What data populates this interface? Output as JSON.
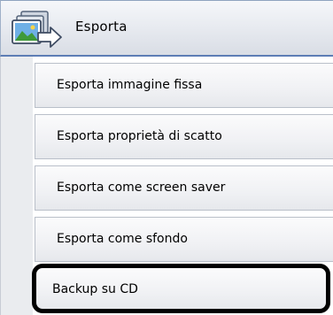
{
  "header": {
    "icon": "export-photos-icon",
    "label": "Esporta"
  },
  "menu": {
    "items": [
      {
        "label": "Esporta immagine fissa"
      },
      {
        "label": "Esporta proprietà di scatto"
      },
      {
        "label": "Esporta come screen saver"
      },
      {
        "label": "Esporta come sfondo"
      },
      {
        "label": "Backup su CD",
        "highlighted": true
      }
    ]
  },
  "colors": {
    "header_bottom_border": "#5d7db5",
    "item_border": "#b9bfc9",
    "highlight_border": "#000000"
  }
}
